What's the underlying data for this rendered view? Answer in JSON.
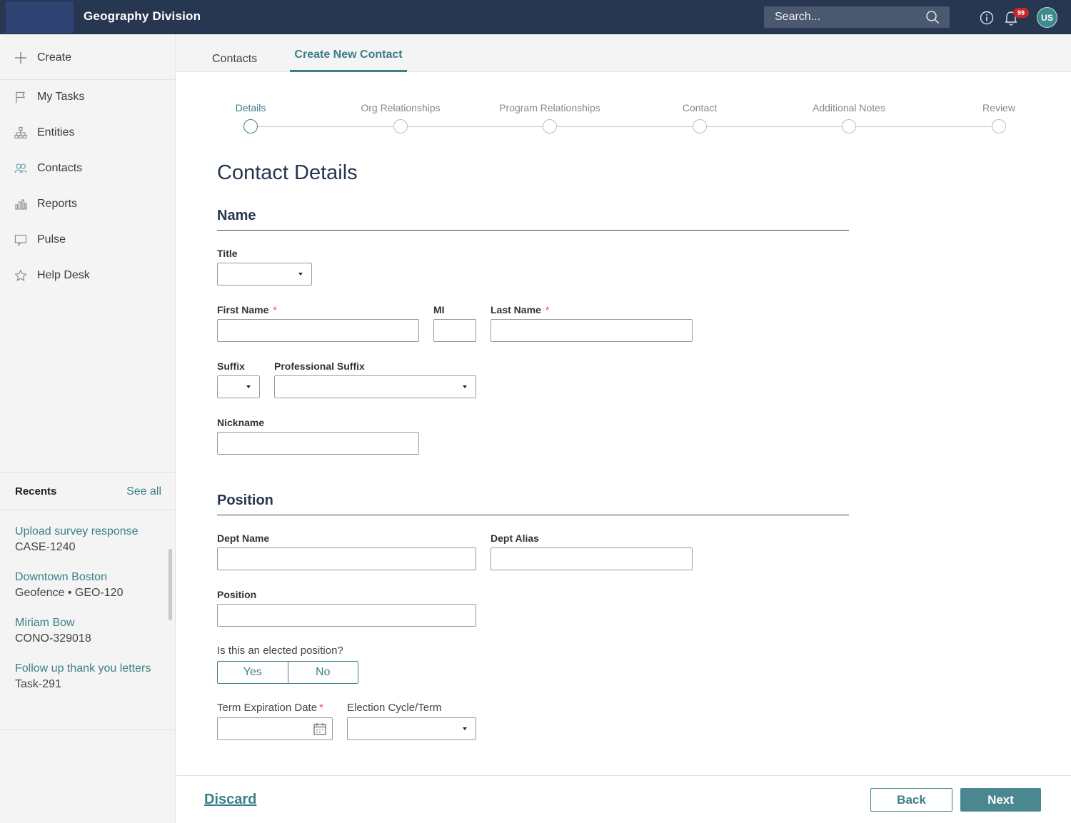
{
  "header": {
    "app_title": "Geography Division",
    "search_placeholder": "Search...",
    "notification_count": "99",
    "avatar_initials": "US",
    "colors": {
      "bar": "#273651",
      "accent": "#3c7f88"
    }
  },
  "sidebar": {
    "create_label": "Create",
    "items": [
      {
        "label": "My Tasks",
        "icon": "flag-icon"
      },
      {
        "label": "Entities",
        "icon": "hierarchy-icon"
      },
      {
        "label": "Contacts",
        "icon": "people-icon"
      },
      {
        "label": "Reports",
        "icon": "bar-chart-icon"
      },
      {
        "label": "Pulse",
        "icon": "monitor-icon"
      },
      {
        "label": "Help Desk",
        "icon": "star-icon"
      }
    ],
    "recents": {
      "title": "Recents",
      "see_all": "See all",
      "items": [
        {
          "title": "Upload survey response",
          "subtitle": "CASE-1240"
        },
        {
          "title": "Downtown Boston",
          "subtitle": "Geofence • GEO-120"
        },
        {
          "title": "Miriam Bow",
          "subtitle": "CONO-329018"
        },
        {
          "title": "Follow up thank you letters",
          "subtitle": "Task-291"
        }
      ]
    }
  },
  "tabs": {
    "contacts": "Contacts",
    "create_new_contact": "Create New Contact",
    "active": "create_new_contact"
  },
  "stepper": {
    "steps": [
      "Details",
      "Org Relationships",
      "Program Relationships",
      "Contact",
      "Additional Notes",
      "Review"
    ],
    "active_index": 0
  },
  "form": {
    "page_title": "Contact Details",
    "name_section": {
      "heading": "Name",
      "title_label": "Title",
      "title_value": "",
      "first_name_label": "First Name",
      "first_name_value": "",
      "mi_label": "MI",
      "mi_value": "",
      "last_name_label": "Last Name",
      "last_name_value": "",
      "required_mark": "*",
      "suffix_label": "Suffix",
      "suffix_value": "",
      "professional_suffix_label": "Professional Suffix",
      "professional_suffix_value": "",
      "nickname_label": "Nickname",
      "nickname_value": ""
    },
    "position_section": {
      "heading": "Position",
      "dept_name_label": "Dept Name",
      "dept_name_value": "",
      "dept_alias_label": "Dept Alias",
      "dept_alias_value": "",
      "position_label": "Position",
      "position_value": "",
      "elected_question": "Is this an elected position?",
      "yes_label": "Yes",
      "no_label": "No",
      "term_expiration_label": "Term Expiration Date",
      "term_expiration_value": "",
      "election_cycle_label": "Election Cycle/Term",
      "election_cycle_value": ""
    }
  },
  "footer": {
    "discard_label": "Discard",
    "back_label": "Back",
    "next_label": "Next"
  }
}
